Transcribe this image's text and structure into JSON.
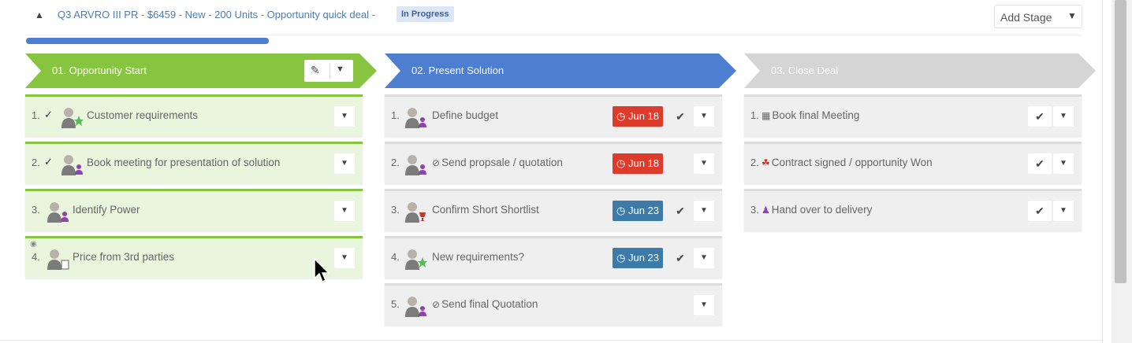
{
  "header": {
    "opportunity_title": "Q3 ARVRO III PR - $6459 - New - 200 Units - Opportunity quick deal -",
    "status": "In Progress",
    "add_stage_label": "Add Stage",
    "progress_fraction": 0.23
  },
  "colors": {
    "stage_done": "#87c540",
    "stage_active": "#4e7ecf",
    "stage_pending": "#d5d5d5",
    "due_overdue": "#dd3b2b",
    "due_upcoming": "#3d7aa7"
  },
  "stages": [
    {
      "title": "01. Opportunity Start",
      "tasks": [
        {
          "num": "1.",
          "text": "Customer requirements",
          "avatar_badge": "star-icon"
        },
        {
          "num": "2.",
          "text": "Book meeting for presentation of solution",
          "avatar_badge": "user-icon"
        },
        {
          "num": "3.",
          "text": "Identify Power",
          "avatar_badge": "user-icon"
        },
        {
          "num": "4.",
          "text": "Price from 3rd parties",
          "avatar_badge": "document-icon"
        }
      ]
    },
    {
      "title": "02. Present Solution",
      "tasks": [
        {
          "num": "1.",
          "text": "Define budget",
          "due": "Jun 18"
        },
        {
          "num": "2.",
          "text": "Send propsale / quotation",
          "due": "Jun 18"
        },
        {
          "num": "3.",
          "text": "Confirm Short Shortlist",
          "due": "Jun 23"
        },
        {
          "num": "4.",
          "text": "New requirements?",
          "due": "Jun 23"
        },
        {
          "num": "5.",
          "text": "Send final Quotation"
        }
      ]
    },
    {
      "title": "03. Close Deal",
      "tasks": [
        {
          "num": "1.",
          "text": "Book final Meeting"
        },
        {
          "num": "2.",
          "text": "Contract signed / opportunity Won"
        },
        {
          "num": "3.",
          "text": "Hand over to delivery"
        }
      ]
    }
  ]
}
